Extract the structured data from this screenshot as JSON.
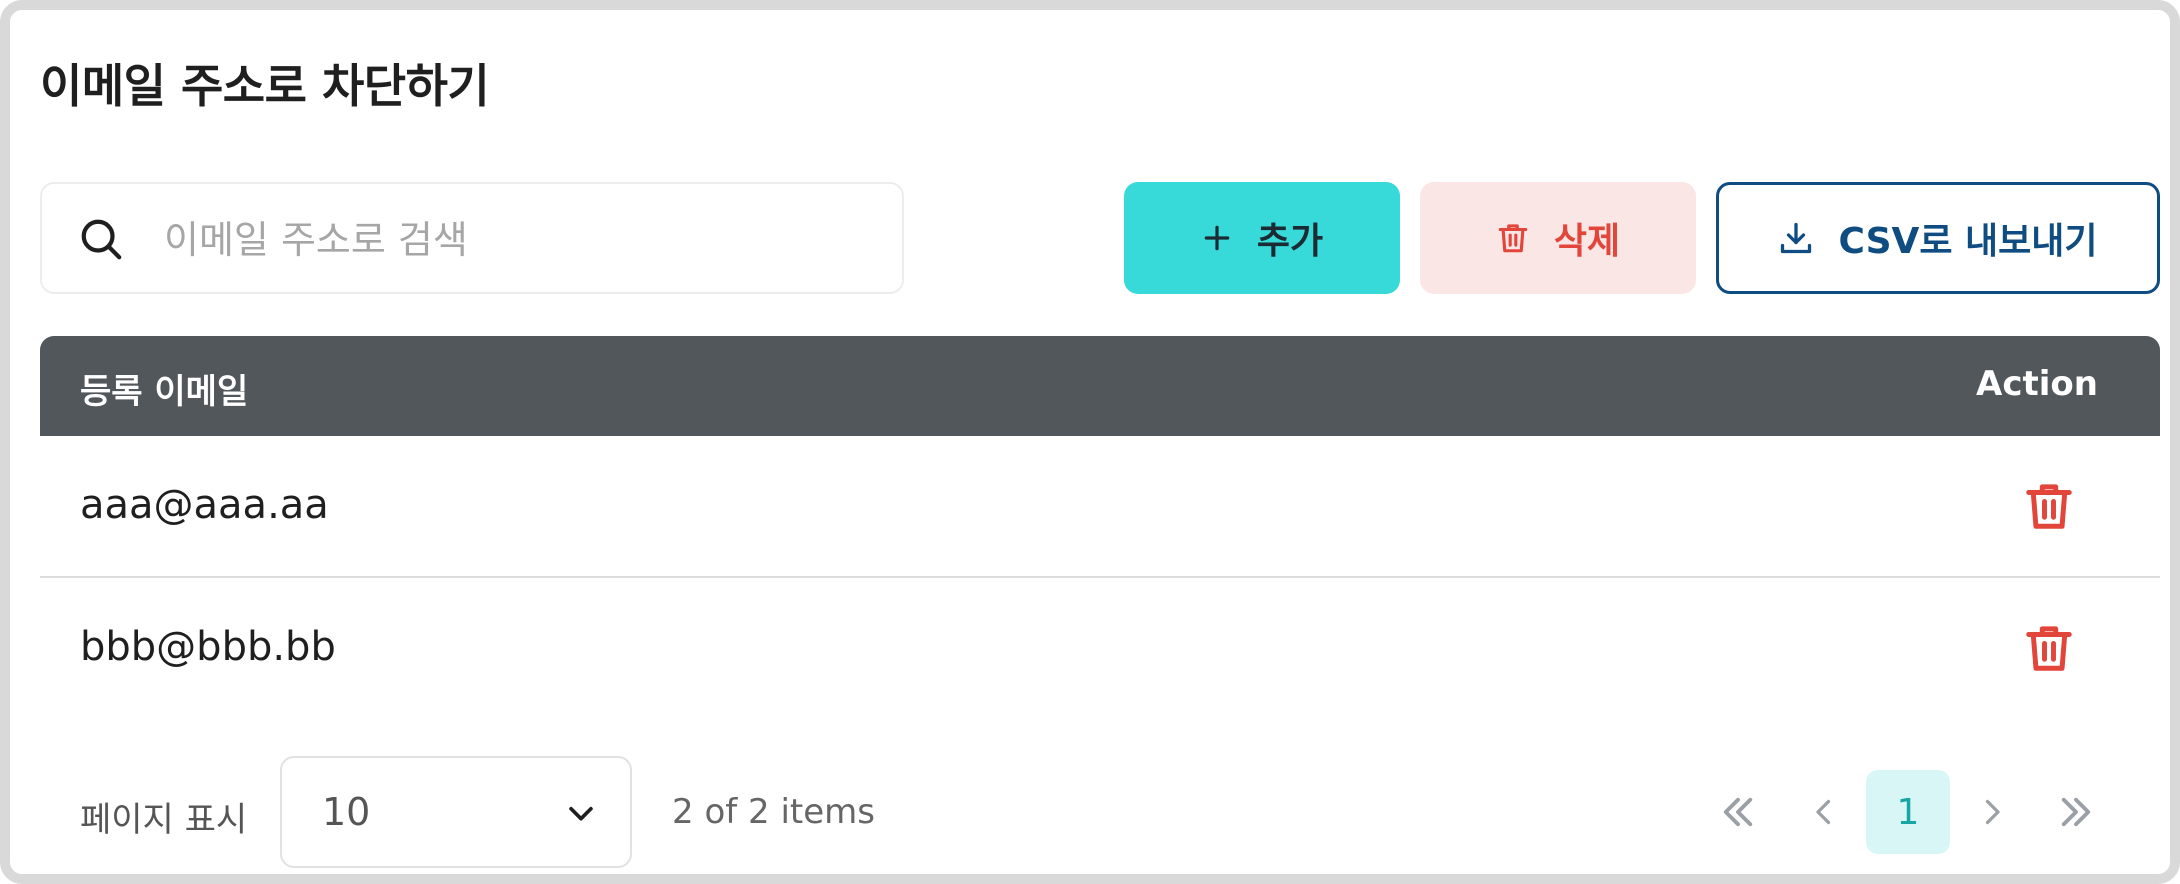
{
  "title": "이메일 주소로 차단하기",
  "search": {
    "placeholder": "이메일 주소로 검색",
    "value": ""
  },
  "toolbar": {
    "add_label": "추가",
    "delete_label": "삭제",
    "csv_label": "CSV로 내보내기"
  },
  "table": {
    "columns": [
      "등록 이메일",
      "Action"
    ],
    "rows": [
      {
        "email": "aaa@aaa.aa"
      },
      {
        "email": "bbb@bbb.bb"
      }
    ]
  },
  "pagination": {
    "page_size_label": "페이지 표시",
    "page_size": "10",
    "items_summary": "2 of 2 items",
    "current_page": "1"
  },
  "colors": {
    "accent": "#38d9d9",
    "danger": "#e2453a",
    "danger_bg": "#fae6e4",
    "primary": "#0f4c81",
    "header_bg": "#52575b"
  },
  "icons": {
    "search": "search-icon",
    "add": "plus-icon",
    "delete": "trash-icon",
    "export": "download-icon",
    "select": "chevron-down-icon",
    "first": "double-chevron-left-icon",
    "prev": "chevron-left-icon",
    "next": "chevron-right-icon",
    "last": "double-chevron-right-icon"
  }
}
